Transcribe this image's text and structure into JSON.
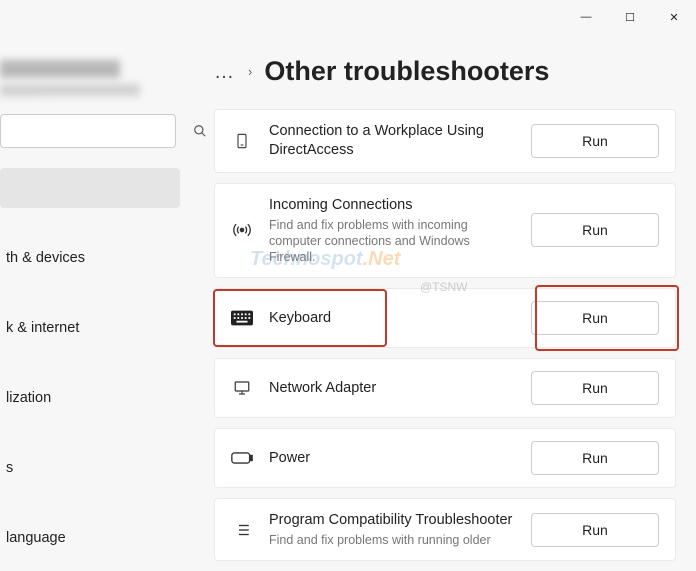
{
  "titlebar": {
    "min": "—",
    "max": "☐",
    "close": "✕"
  },
  "search": {
    "placeholder": ""
  },
  "nav": {
    "items": [
      {
        "label": "th & devices"
      },
      {
        "label": "k & internet"
      },
      {
        "label": "lization"
      },
      {
        "label": "s"
      },
      {
        "label": "language"
      }
    ]
  },
  "breadcrumb": {
    "more": "…",
    "sep": "›"
  },
  "page_title": "Other troubleshooters",
  "troubleshooters": [
    {
      "title": "Connection to a Workplace Using DirectAccess",
      "desc": "",
      "run_label": "Run",
      "icon": "phone"
    },
    {
      "title": "Incoming Connections",
      "desc": "Find and fix problems with incoming computer connections and Windows Firewall.",
      "run_label": "Run",
      "icon": "antenna"
    },
    {
      "title": "Keyboard",
      "desc": "",
      "run_label": "Run",
      "icon": "keyboard",
      "highlight": true
    },
    {
      "title": "Network Adapter",
      "desc": "",
      "run_label": "Run",
      "icon": "monitor"
    },
    {
      "title": "Power",
      "desc": "",
      "run_label": "Run",
      "icon": "battery"
    },
    {
      "title": "Program Compatibility Troubleshooter",
      "desc": "Find and fix problems with running older",
      "run_label": "Run",
      "icon": "list"
    }
  ],
  "watermark": {
    "text1": "Technospot",
    "text2": ".Net",
    "sub": "@TSNW"
  }
}
